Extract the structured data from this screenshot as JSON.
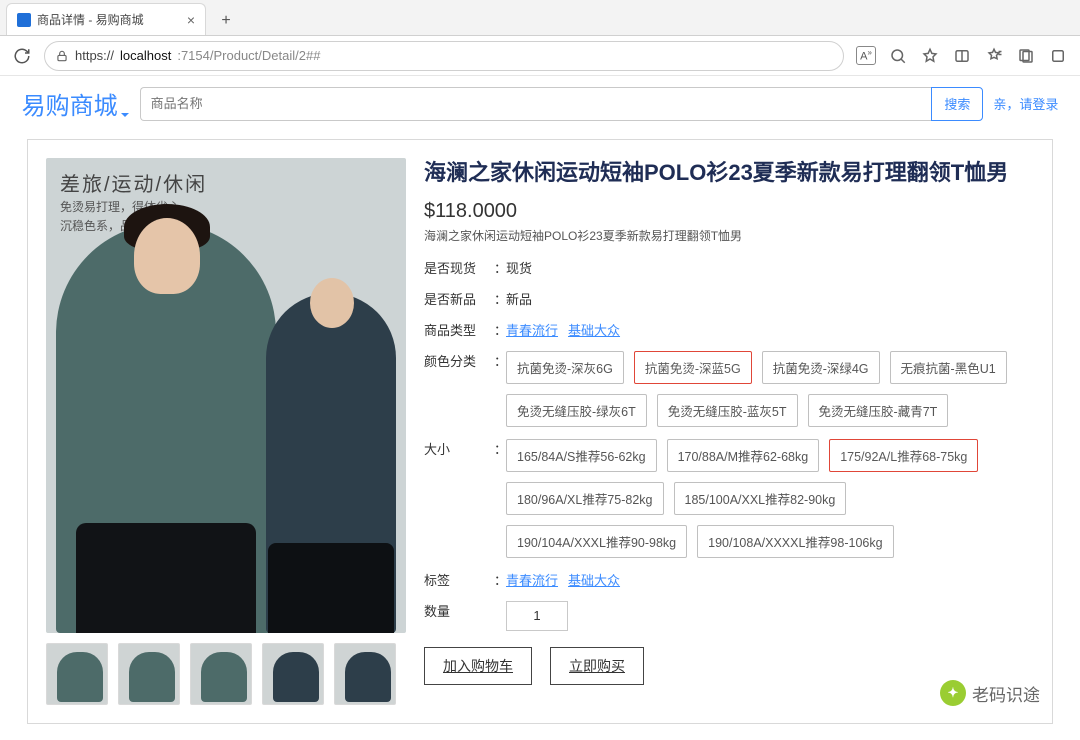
{
  "chrome": {
    "tab_title": "商品详情 - 易购商城",
    "url_prefix": "https://",
    "url_host": "localhost",
    "url_rest": ":7154/Product/Detail/2##"
  },
  "header": {
    "brand": "易购商城",
    "search_placeholder": "商品名称",
    "search_btn": "搜索",
    "login": "亲，请登录"
  },
  "poster": {
    "headline": "差旅/运动/休闲",
    "sub1": "免烫易打理，得体省心",
    "sub2": "沉稳色系，品质穿搭"
  },
  "product": {
    "title": "海澜之家休闲运动短袖POLO衫23夏季新款易打理翻领T恤男",
    "price": "$118.0000",
    "subtitle": "海澜之家休闲运动短袖POLO衫23夏季新款易打理翻领T恤男",
    "attrs": {
      "stock_label": "是否现货",
      "stock_value": "现货",
      "new_label": "是否新品",
      "new_value": "新品",
      "type_label": "商品类型",
      "type_links": [
        "青春流行",
        "基础大众"
      ],
      "color_label": "颜色分类",
      "size_label": "大小",
      "tag_label": "标签",
      "tag_links": [
        "青春流行",
        "基础大众"
      ],
      "qty_label": "数量",
      "qty_value": "1"
    },
    "colors": [
      {
        "text": "抗菌免烫-深灰6G",
        "selected": false
      },
      {
        "text": "抗菌免烫-深蓝5G",
        "selected": true
      },
      {
        "text": "抗菌免烫-深绿4G",
        "selected": false
      },
      {
        "text": "无痕抗菌-黑色U1",
        "selected": false
      },
      {
        "text": "免烫无缝压胶-绿灰6T",
        "selected": false
      },
      {
        "text": "免烫无缝压胶-蓝灰5T",
        "selected": false
      },
      {
        "text": "免烫无缝压胶-藏青7T",
        "selected": false
      }
    ],
    "sizes": [
      {
        "text": "165/84A/S推荐56-62kg",
        "selected": false
      },
      {
        "text": "170/88A/M推荐62-68kg",
        "selected": false
      },
      {
        "text": "175/92A/L推荐68-75kg",
        "selected": true
      },
      {
        "text": "180/96A/XL推荐75-82kg",
        "selected": false
      },
      {
        "text": "185/100A/XXL推荐82-90kg",
        "selected": false
      },
      {
        "text": "190/104A/XXXL推荐90-98kg",
        "selected": false
      },
      {
        "text": "190/108A/XXXXL推荐98-106kg",
        "selected": false
      }
    ],
    "actions": {
      "add_cart": "加入购物车",
      "buy_now": "立即购买"
    }
  },
  "watermark": "老码识途"
}
